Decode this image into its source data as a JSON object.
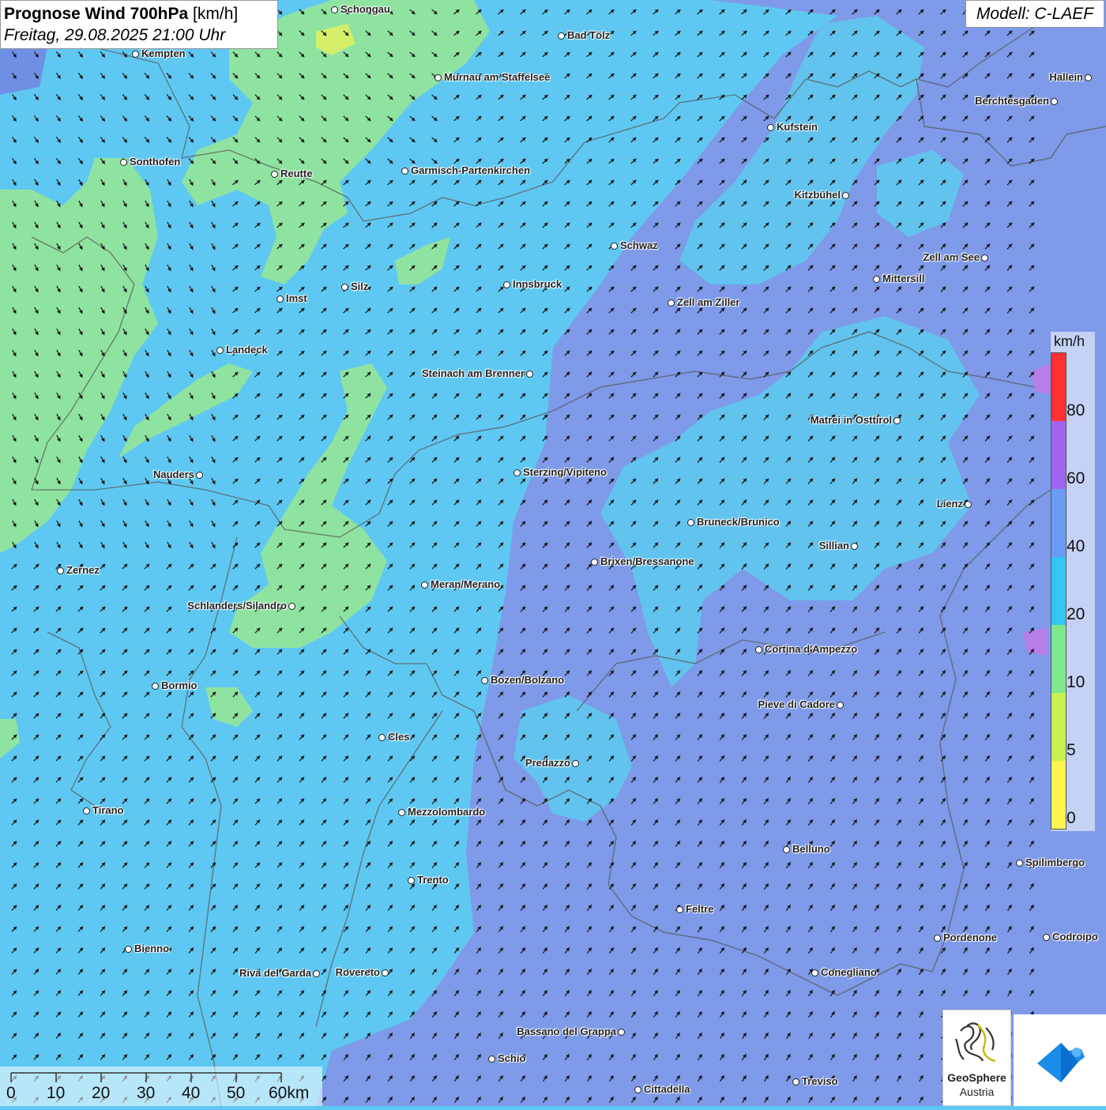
{
  "title": {
    "bold": "Prognose Wind 700hPa",
    "unit": " [km/h]",
    "date": "Freitag, 29.08.2025 21:00 Uhr"
  },
  "model": "Modell: C-LAEF",
  "legend": {
    "unit": "km/h",
    "labels": [
      "80",
      "60",
      "40",
      "20",
      "10",
      "5",
      "0"
    ],
    "colors": [
      "#ff3030",
      "#a066f0",
      "#6a9cf5",
      "#34c6f2",
      "#7ee88a",
      "#c8f04e",
      "#fff44d"
    ]
  },
  "scale": {
    "labels": [
      "0",
      "10",
      "20",
      "30",
      "40",
      "50",
      "60km"
    ]
  },
  "logo": {
    "name": "GeoSphere",
    "sub": "Austria"
  },
  "cities": [
    {
      "name": "Schongau"
    },
    {
      "name": "Bad Tölz"
    },
    {
      "name": "Kempten"
    },
    {
      "name": "Murnau am Staffelsee"
    },
    {
      "name": "Hallein"
    },
    {
      "name": "Berchtesgaden"
    },
    {
      "name": "Kufstein"
    },
    {
      "name": "Sonthofen"
    },
    {
      "name": "Reutte"
    },
    {
      "name": "Garmisch-Partenkirchen"
    },
    {
      "name": "Kitzbühel"
    },
    {
      "name": "Schwaz"
    },
    {
      "name": "Zell am See"
    },
    {
      "name": "Mittersill"
    },
    {
      "name": "Innsbruck"
    },
    {
      "name": "Silz"
    },
    {
      "name": "Imst"
    },
    {
      "name": "Zell am Ziller"
    },
    {
      "name": "Landeck"
    },
    {
      "name": "Steinach am Brenner"
    },
    {
      "name": "Matrei in Osttirol"
    },
    {
      "name": "Nauders"
    },
    {
      "name": "Sterzing/Vipiteno"
    },
    {
      "name": "Lienz"
    },
    {
      "name": "Bruneck/Brunico"
    },
    {
      "name": "Sillian"
    },
    {
      "name": "Zernez"
    },
    {
      "name": "Brixen/Bressanone"
    },
    {
      "name": "Meran/Merano"
    },
    {
      "name": "Schlanders/Silandro"
    },
    {
      "name": "Cortina d'Ampezzo"
    },
    {
      "name": "Bormio"
    },
    {
      "name": "Bozen/Bolzano"
    },
    {
      "name": "Pieve di Cadore"
    },
    {
      "name": "Cles"
    },
    {
      "name": "Predazzo"
    },
    {
      "name": "Tirano"
    },
    {
      "name": "Mezzolombardo"
    },
    {
      "name": "Belluno"
    },
    {
      "name": "Spilimbergo"
    },
    {
      "name": "Trento"
    },
    {
      "name": "Feltre"
    },
    {
      "name": "Bienno"
    },
    {
      "name": "Pordenone"
    },
    {
      "name": "Codroipo"
    },
    {
      "name": "Riva del Garda"
    },
    {
      "name": "Rovereto"
    },
    {
      "name": "Conegliano"
    },
    {
      "name": "Bassano del Grappa"
    },
    {
      "name": "Schio"
    },
    {
      "name": "Treviso"
    },
    {
      "name": "Cittadella"
    }
  ]
}
